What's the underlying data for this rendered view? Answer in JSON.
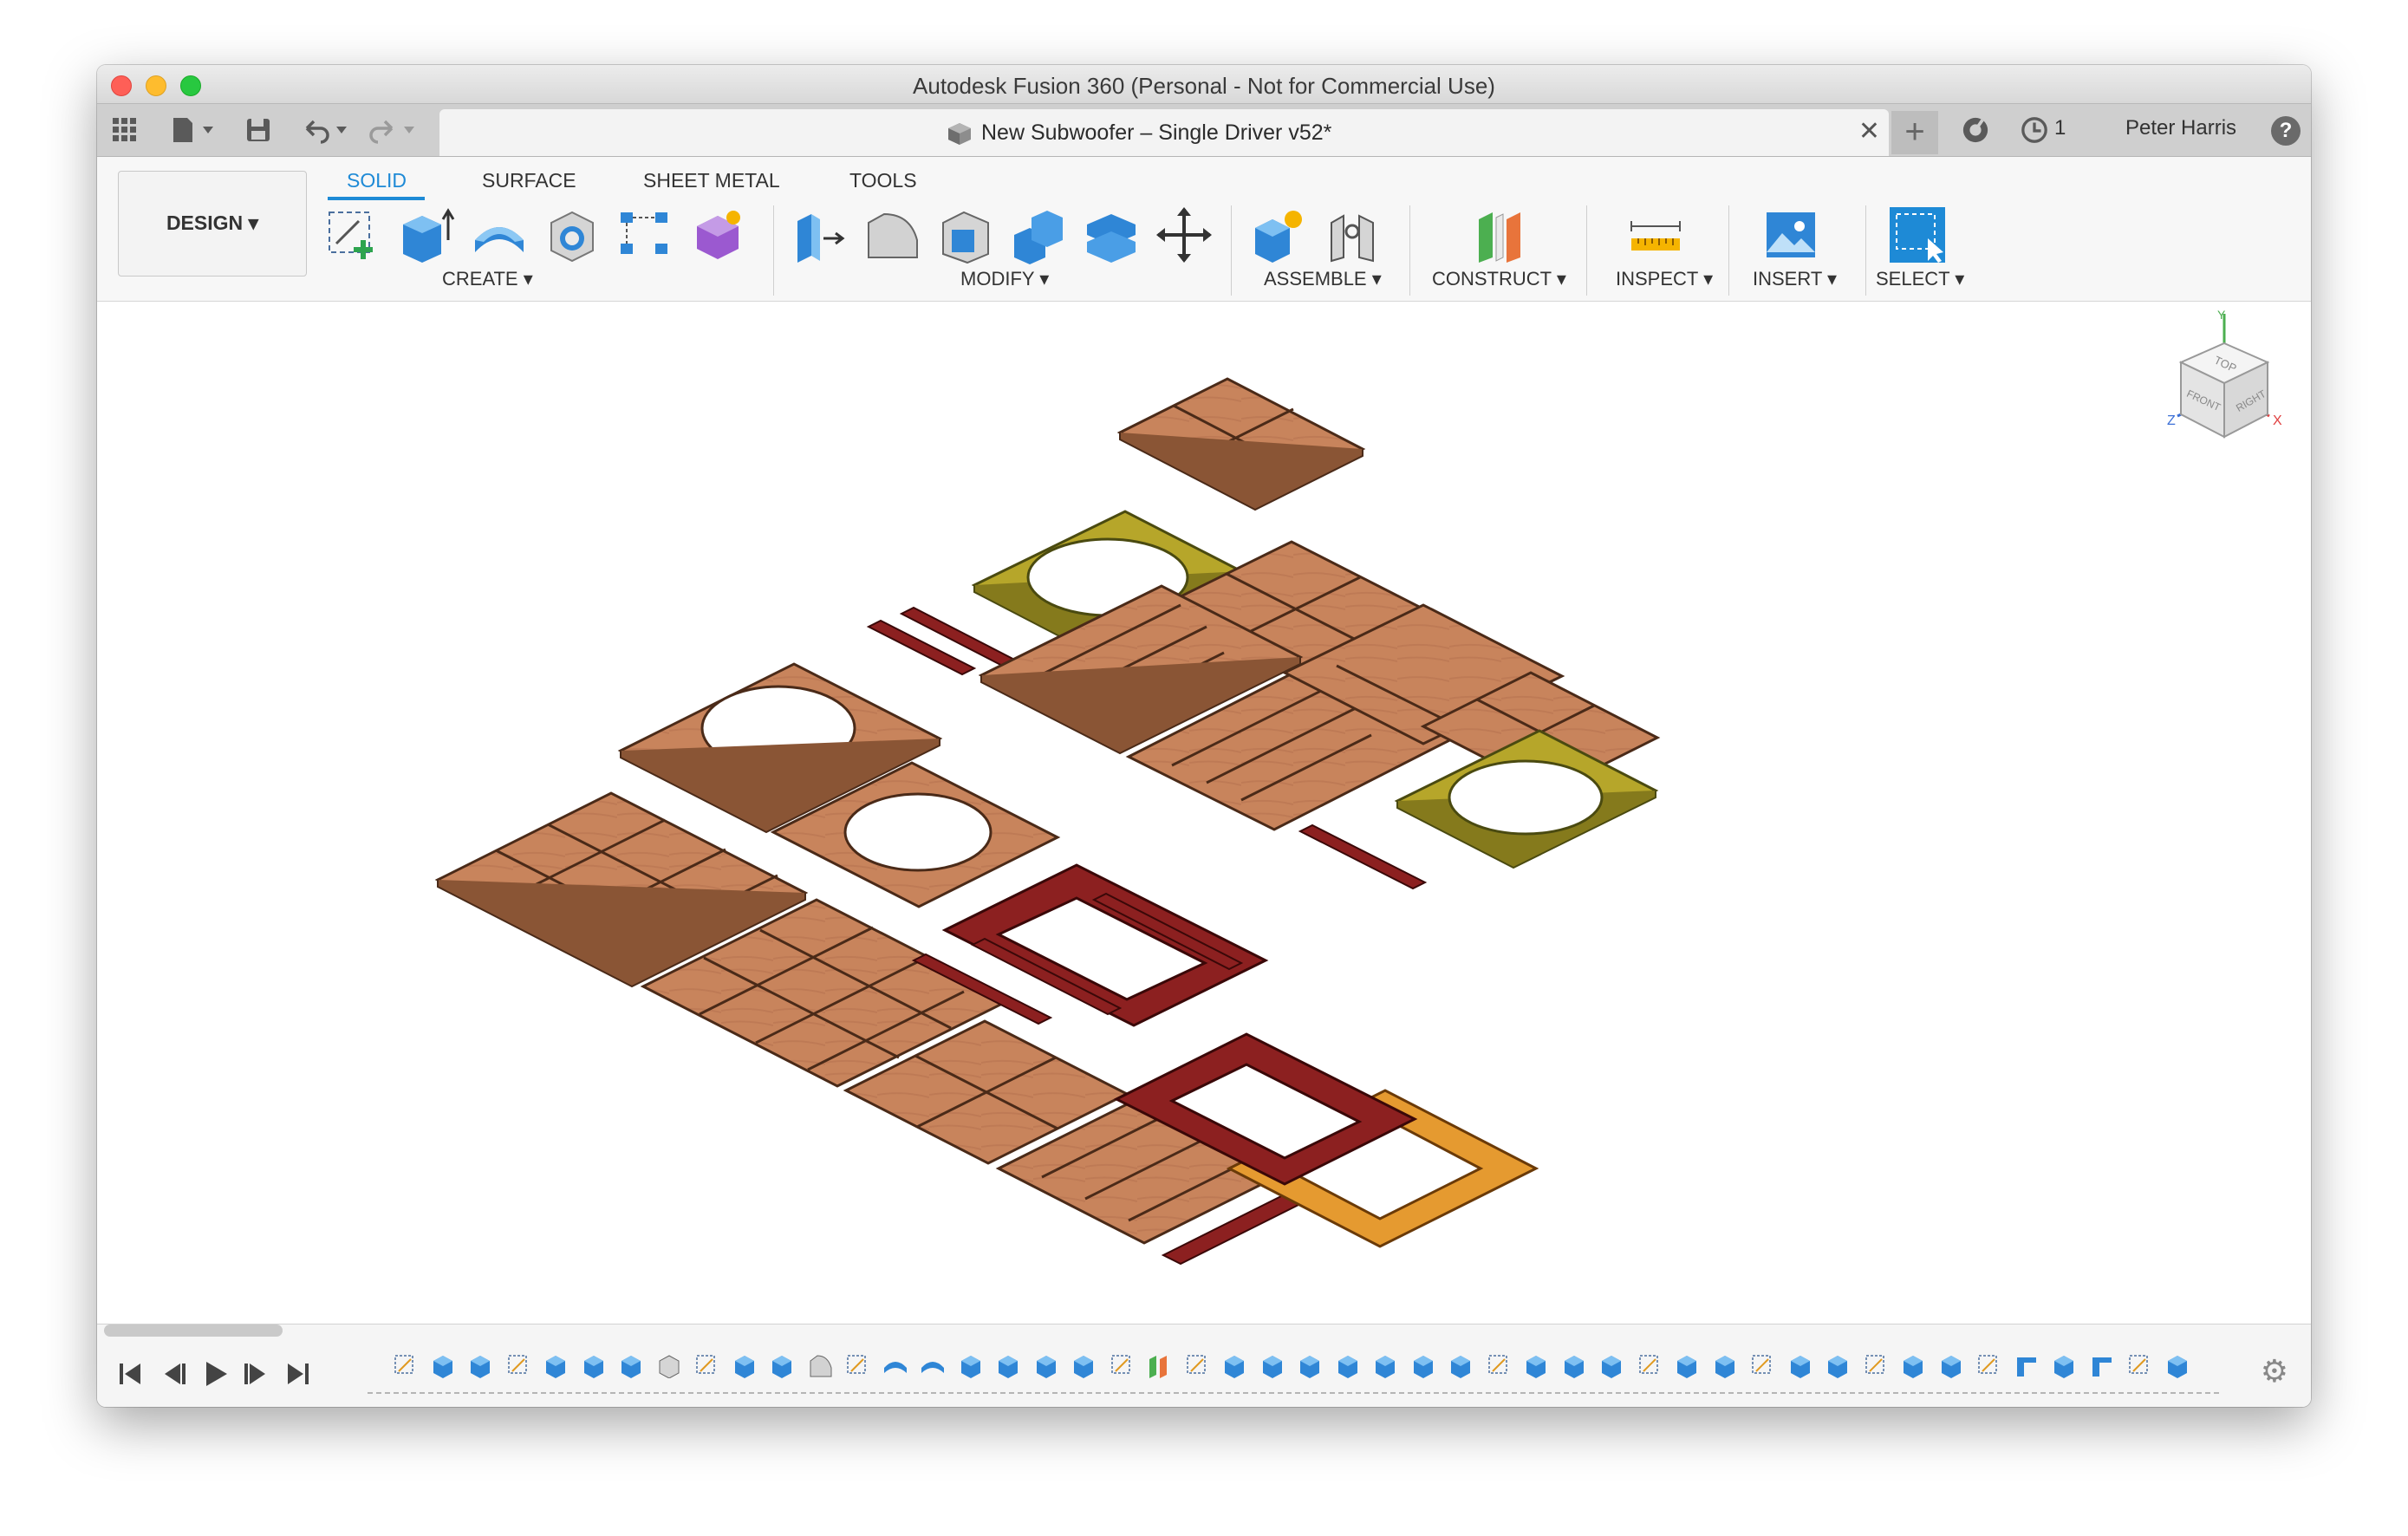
{
  "window": {
    "title": "Autodesk Fusion 360 (Personal - Not for Commercial Use)"
  },
  "tabbar": {
    "document_title": "New Subwoofer – Single Driver v52*",
    "close_glyph": "✕",
    "job_count": "1",
    "user_name": "Peter Harris",
    "help_glyph": "?"
  },
  "toolbar": {
    "workspace": "DESIGN",
    "tabs": [
      "SOLID",
      "SURFACE",
      "SHEET METAL",
      "TOOLS"
    ],
    "active_tab": "SOLID",
    "groups": {
      "create": "CREATE",
      "modify": "MODIFY",
      "assemble": "ASSEMBLE",
      "construct": "CONSTRUCT",
      "inspect": "INSPECT",
      "insert": "INSERT",
      "select": "SELECT"
    }
  },
  "viewcube": {
    "top": "TOP",
    "front": "FRONT",
    "right": "RIGHT",
    "x": "X",
    "y": "Y",
    "z": "Z"
  },
  "timeline": {
    "features": [
      "sketch",
      "extrude",
      "extrude",
      "sketch",
      "extrude",
      "extrude",
      "extrude",
      "shell",
      "sketch",
      "extrude",
      "extrude",
      "fillet",
      "sketch",
      "split",
      "split",
      "extrude",
      "extrude",
      "extrude",
      "extrude",
      "sketch",
      "plane",
      "sketch",
      "extrude",
      "extrude",
      "extrude",
      "extrude",
      "extrude",
      "extrude",
      "extrude",
      "sketch",
      "extrude",
      "extrude",
      "extrude",
      "sketch",
      "extrude",
      "extrude",
      "sketch",
      "extrude",
      "extrude",
      "sketch",
      "extrude",
      "extrude",
      "sketch",
      "joint",
      "extrude",
      "joint",
      "sketch",
      "extrude"
    ]
  },
  "colors": {
    "plywood": "#c8845c",
    "yellow_panel": "#b6a62a",
    "dark_red": "#8c2020",
    "orange_panel": "#e59a30",
    "accent": "#1e8ad6"
  }
}
